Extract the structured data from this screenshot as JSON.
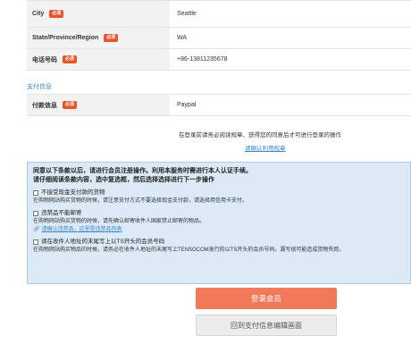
{
  "address_form": {
    "rows": [
      {
        "label": "City",
        "required_badge": "必须",
        "value": "Seattle"
      },
      {
        "label": "State/Province/Region",
        "required_badge": "必须",
        "value": "WA"
      },
      {
        "label": "电话号码",
        "required_badge": "必须",
        "value": "+86-13811235678"
      }
    ]
  },
  "payment": {
    "section_title": "支付信息",
    "label": "付款信息",
    "required_badge": "必须",
    "value": "Paypal"
  },
  "login_note": "在登录前请务必阅读规章、获得您的同意后才可进行登录的操作",
  "terms_link": "请确认利用规章",
  "terms_box": {
    "header_line1": "同意以下条款以后，请进行会员注册操作。利用本服务时需进行本人认证手续。",
    "header_line2": "请仔细阅读条款内容，选中复选框，然后选择选择进行下一步操作",
    "items": [
      {
        "title": "不接受现金支付款的货物",
        "desc": "在购物网站购买货物的时候，请注意支付方式不要选择现金支付款，请选择用信用卡支付。"
      },
      {
        "title": "违禁品不能邮寄",
        "desc": "在购物网站购买货物的时候，请先确认邮寄收件人国家禁止邮寄的物品。",
        "link": "请确认违禁品，这里是违禁品列表"
      },
      {
        "title": "请在收件人地址的末尾写上以TS开头的会员号码",
        "desc": "在购物网站购买物品的时候，请务必在收件人地址的末尾写上TENSOCOM发行的以TS开头的会员号码。漏写很可能造成货物失踪。"
      }
    ]
  },
  "buttons": {
    "register": "登录会员",
    "back": "回到支付信息编辑画面"
  },
  "colors": {
    "accent_blue": "#3a86c8",
    "badge_red": "#e8552c",
    "register_button": "#f0795a",
    "terms_box_bg": "#dbeaf6"
  }
}
